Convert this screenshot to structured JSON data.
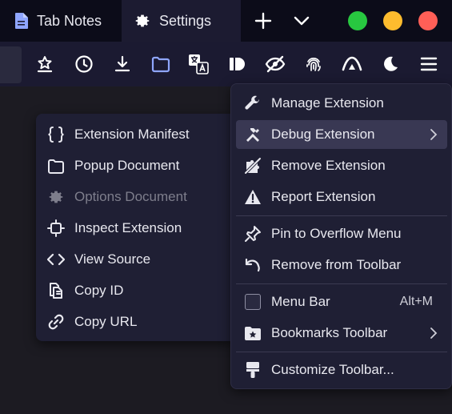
{
  "tabs": [
    {
      "label": "Tab Notes",
      "icon": "document-icon"
    },
    {
      "label": "Settings",
      "icon": "gear-icon",
      "selected": true
    }
  ],
  "tab_actions": [
    "new-tab-icon",
    "list-all-tabs-icon"
  ],
  "window_controls": {
    "colors": [
      "#28c840",
      "#febc2e",
      "#ff5f57"
    ]
  },
  "toolbar": {
    "icons": [
      "bookmark-star-icon",
      "history-icon",
      "downloads-icon",
      "extension-sidebar-icon",
      "translate-icon",
      "id-extension-icon",
      "privacy-eye-icon",
      "fingerprint-icon",
      "proton-vpn-icon",
      "dark-reader-icon",
      "hamburger-menu-icon"
    ],
    "accent": "#8fa6ff"
  },
  "debug_menu": {
    "items": [
      {
        "label": "Extension Manifest",
        "icon": "braces-icon",
        "enabled": true
      },
      {
        "label": "Popup Document",
        "icon": "popup-icon",
        "enabled": true
      },
      {
        "label": "Options Document",
        "icon": "gear-icon",
        "enabled": false
      },
      {
        "label": "Inspect Extension",
        "icon": "inspect-icon",
        "enabled": true
      },
      {
        "label": "View Source",
        "icon": "code-icon",
        "enabled": true
      },
      {
        "label": "Copy ID",
        "icon": "copy-icon",
        "enabled": true
      },
      {
        "label": "Copy URL",
        "icon": "link-icon",
        "enabled": true
      }
    ]
  },
  "context_menu": {
    "manage": "Manage Extension",
    "debug": "Debug Extension",
    "remove_ext": "Remove Extension",
    "report": "Report Extension",
    "pin": "Pin to Overflow Menu",
    "remove_toolbar": "Remove from Toolbar",
    "menu_bar": "Menu Bar",
    "menu_bar_shortcut": "Alt+M",
    "bookmarks_toolbar": "Bookmarks Toolbar",
    "customize": "Customize Toolbar..."
  }
}
